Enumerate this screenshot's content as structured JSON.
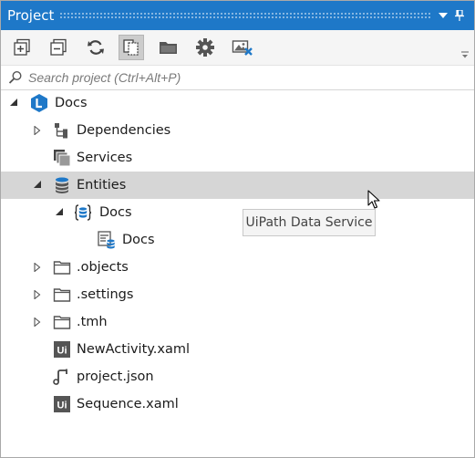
{
  "panel": {
    "title": "Project"
  },
  "toolbar": {
    "buttons": [
      {
        "name": "expand-all",
        "icon": "expand-all-icon"
      },
      {
        "name": "collapse-all",
        "icon": "collapse-all-icon"
      },
      {
        "name": "refresh",
        "icon": "refresh-icon"
      },
      {
        "name": "show-all-files",
        "icon": "show-all-files-icon",
        "active": true
      },
      {
        "name": "open-folder",
        "icon": "folder-open-icon"
      },
      {
        "name": "settings",
        "icon": "gear-icon"
      },
      {
        "name": "remove-unused",
        "icon": "image-remove-icon"
      }
    ]
  },
  "search": {
    "placeholder": "Search project (Ctrl+Alt+P)"
  },
  "tree": {
    "root": {
      "label": "Docs",
      "expanded": true
    },
    "items": [
      {
        "label": "Dependencies",
        "icon": "dependencies-icon",
        "expander": "collapsed"
      },
      {
        "label": "Services",
        "icon": "services-icon",
        "expander": "none"
      },
      {
        "label": "Entities",
        "icon": "database-icon",
        "expander": "expanded",
        "selected": true
      },
      {
        "label": "Docs",
        "icon": "entity-namespace-icon",
        "expander": "expanded"
      },
      {
        "label": "Docs",
        "icon": "entity-table-icon",
        "expander": "none"
      },
      {
        "label": ".objects",
        "icon": "folder-icon",
        "expander": "collapsed"
      },
      {
        "label": ".settings",
        "icon": "folder-icon",
        "expander": "collapsed"
      },
      {
        "label": ".tmh",
        "icon": "folder-icon",
        "expander": "collapsed"
      },
      {
        "label": "NewActivity.xaml",
        "icon": "ui-file-icon",
        "expander": "none"
      },
      {
        "label": "project.json",
        "icon": "json-file-icon",
        "expander": "none"
      },
      {
        "label": "Sequence.xaml",
        "icon": "ui-file-icon",
        "expander": "none"
      }
    ]
  },
  "tooltip": {
    "text": "UiPath Data Service"
  },
  "colors": {
    "title_bar": "#1e78c8",
    "selection": "#d6d6d6",
    "accent_blue": "#1e78c8",
    "icon_gray": "#555555"
  }
}
